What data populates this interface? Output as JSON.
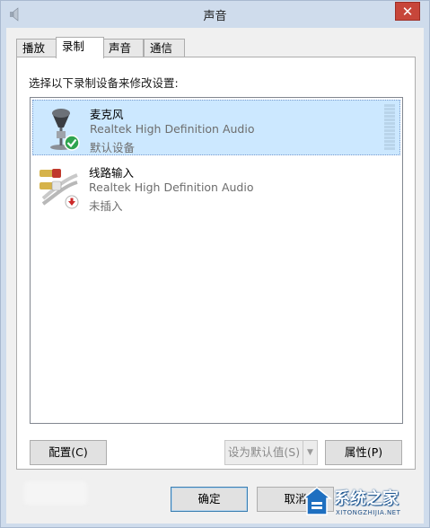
{
  "window": {
    "title": "声音",
    "app_icon": "speaker-icon",
    "close_glyph": "✕"
  },
  "tabs": [
    {
      "label": "播放"
    },
    {
      "label": "录制",
      "active": true
    },
    {
      "label": "声音"
    },
    {
      "label": "通信"
    }
  ],
  "instruction": "选择以下录制设备来修改设置:",
  "devices": [
    {
      "name": "麦克风",
      "description": "Realtek High Definition Audio",
      "status": "默认设备",
      "icon": "microphone-icon",
      "badge": "green-check-icon",
      "selected": true
    },
    {
      "name": "线路输入",
      "description": "Realtek High Definition Audio",
      "status": "未插入",
      "icon": "rca-cable-icon",
      "badge": "red-down-arrow-icon",
      "selected": false
    }
  ],
  "buttons": {
    "configure": "配置(C)",
    "set_default": "设为默认值(S)",
    "properties": "属性(P)",
    "ok": "确定",
    "cancel": "取消"
  },
  "watermark": {
    "text": "系统之家",
    "url": "XITONGZHIJIA.NET"
  }
}
